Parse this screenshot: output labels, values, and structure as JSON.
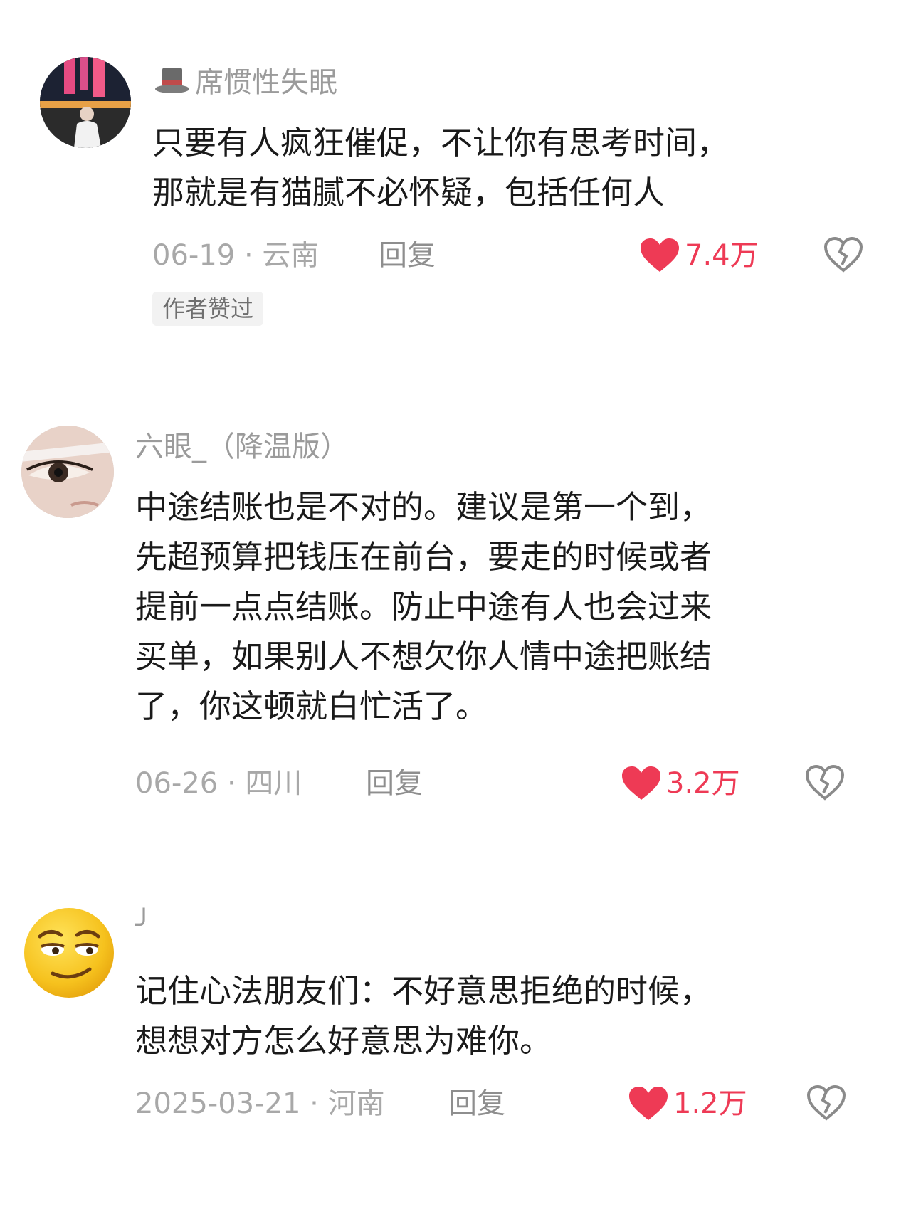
{
  "comments": [
    {
      "username": "席惯性失眠",
      "has_hat_icon": true,
      "text": "只要有人疯狂催促，不让你有思考时间，\n那就是有猫腻不必怀疑，包括任何人",
      "date_location": "06-19 · 云南",
      "reply_label": "回复",
      "likes": "7.4万",
      "badge": "作者赞过"
    },
    {
      "username": "六眼_（降温版）",
      "text": "中途结账也是不对的。建议是第一个到，\n先超预算把钱压在前台，要走的时候或者\n提前一点点结账。防止中途有人也会过来\n买单，如果别人不想欠你人情中途把账结\n了，你这顿就白忙活了。",
      "date_location": "06-26 · 四川",
      "reply_label": "回复",
      "likes": "3.2万"
    },
    {
      "username": "╯",
      "text": "记住心法朋友们：不好意思拒绝的时候，\n想想对方怎么好意思为难你。",
      "date_location": "2025-03-21 · 河南",
      "reply_label": "回复",
      "likes": "1.2万"
    }
  ],
  "colors": {
    "like_red": "#ee3a55",
    "muted_gray": "#a8a8a8",
    "text_dark": "#1a1a1a"
  },
  "icons": {
    "like": "heart-icon",
    "dislike": "broken-heart-icon",
    "hat": "top-hat-icon"
  }
}
